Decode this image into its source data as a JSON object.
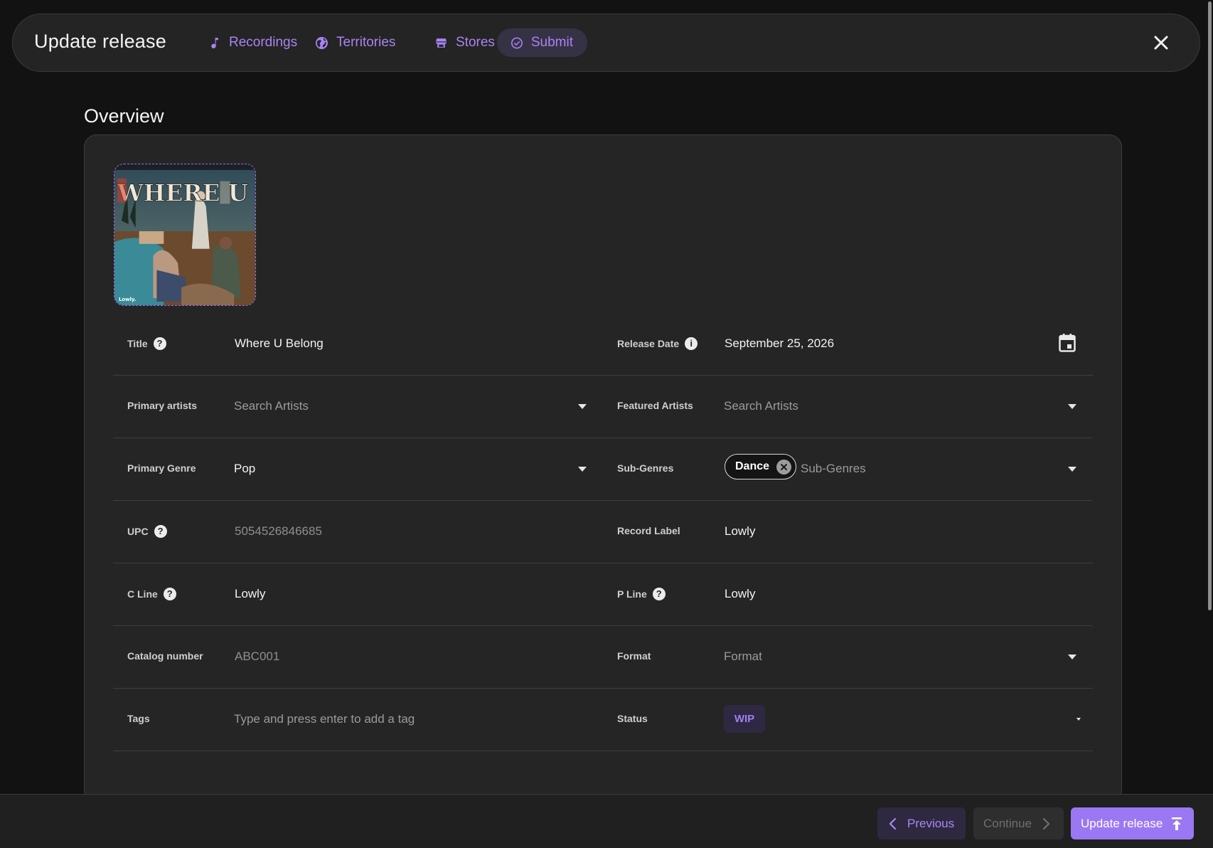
{
  "header": {
    "title": "Update release",
    "tabs": [
      {
        "label": "Recordings",
        "icon": "music-note-icon"
      },
      {
        "label": "Territories",
        "icon": "globe-icon"
      },
      {
        "label": "Stores",
        "icon": "store-icon"
      },
      {
        "label": "Submit",
        "icon": "check-circle-icon",
        "active": true
      }
    ],
    "close_icon": "close-icon"
  },
  "section": {
    "title": "Overview"
  },
  "cover": {
    "art_text": "WHERE U BELONG",
    "label_text": "Lowly."
  },
  "form": {
    "title": {
      "label": "Title",
      "value": "Where U Belong"
    },
    "release_date": {
      "label": "Release Date",
      "value": "September 25, 2026"
    },
    "primary_artists": {
      "label": "Primary artists",
      "placeholder": "Search Artists"
    },
    "featured_artists": {
      "label": "Featured Artists",
      "placeholder": "Search Artists"
    },
    "primary_genre": {
      "label": "Primary Genre",
      "value": "Pop"
    },
    "sub_genres": {
      "label": "Sub-Genres",
      "chips": [
        "Dance"
      ],
      "placeholder": "Sub-Genres"
    },
    "upc": {
      "label": "UPC",
      "value": "5054526846685"
    },
    "record_label": {
      "label": "Record Label",
      "value": "Lowly"
    },
    "c_line": {
      "label": "C Line",
      "value": "Lowly"
    },
    "p_line": {
      "label": "P Line",
      "value": "Lowly"
    },
    "catalog_number": {
      "label": "Catalog number",
      "value": "ABC001"
    },
    "format": {
      "label": "Format",
      "placeholder": "Format"
    },
    "tags": {
      "label": "Tags",
      "placeholder": "Type and press enter to add a tag"
    },
    "status": {
      "label": "Status",
      "value": "WIP"
    }
  },
  "footer": {
    "previous": "Previous",
    "continue": "Continue",
    "update": "Update release"
  },
  "colors": {
    "accent": "#9b78f3",
    "accent_text": "#a784f2",
    "background": "#121212",
    "card": "#252525"
  }
}
